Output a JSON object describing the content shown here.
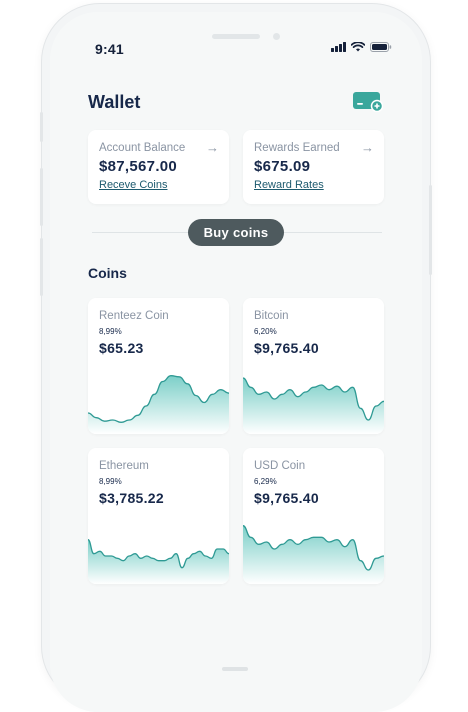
{
  "status_bar": {
    "time": "9:41"
  },
  "header": {
    "title": "Wallet",
    "wallet_icon": "wallet-add-icon",
    "accent": "#3aa79c"
  },
  "balances": [
    {
      "label": "Account Balance",
      "value": "$87,567.00",
      "link": "Receve Coins"
    },
    {
      "label": "Rewards Earned",
      "value": "$675.09",
      "link": "Reward Rates"
    }
  ],
  "actions": {
    "buy_label": "Buy coins"
  },
  "coins_section": {
    "title": "Coins"
  },
  "coins": [
    {
      "name": "Renteez Coin",
      "change": "8,99%",
      "price": "$65.23",
      "spark": [
        18,
        14,
        11,
        12,
        10,
        12,
        16,
        24,
        34,
        45,
        50,
        49,
        43,
        33,
        27,
        34,
        38,
        35
      ]
    },
    {
      "name": "Bitcoin",
      "change": "6,20%",
      "price": "$9,765.40",
      "spark": [
        48,
        40,
        34,
        36,
        30,
        34,
        38,
        32,
        36,
        40,
        42,
        38,
        41,
        36,
        40,
        22,
        12,
        24,
        28
      ]
    },
    {
      "name": "Ethereum",
      "change": "8,99%",
      "price": "$3,785.22",
      "spark": [
        38,
        26,
        28,
        24,
        24,
        22,
        20,
        24,
        26,
        22,
        24,
        22,
        20,
        20,
        22,
        26,
        14,
        22,
        26,
        28,
        24,
        22,
        30,
        30,
        26
      ]
    },
    {
      "name": "USD Coin",
      "change": "6,29%",
      "price": "$9,765.40",
      "spark": [
        50,
        40,
        34,
        36,
        30,
        34,
        38,
        34,
        38,
        40,
        40,
        36,
        38,
        32,
        38,
        20,
        12,
        22,
        24
      ]
    }
  ],
  "colors": {
    "spark_line": "#2f9a94",
    "spark_fill_top": "#7ccfc8",
    "spark_fill_bottom": "#ffffff",
    "text_dark": "#17284a",
    "muted": "#8a94a3"
  }
}
